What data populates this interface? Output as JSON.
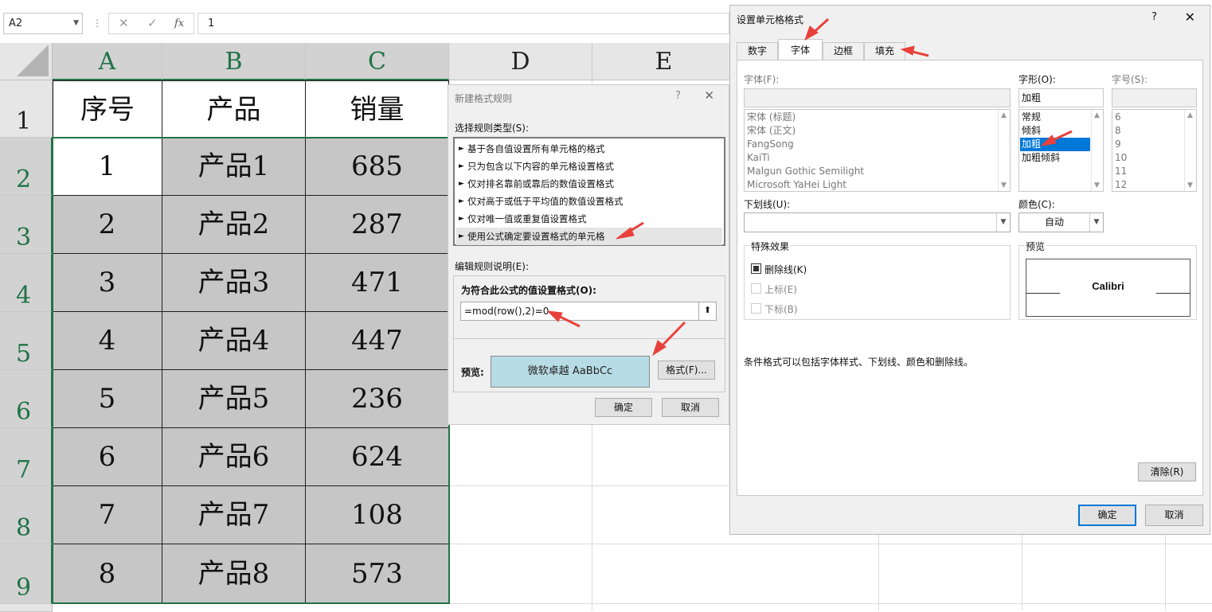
{
  "formula_bar": {
    "name_box": "A2",
    "cancel_icon": "✕",
    "enter_icon": "✓",
    "fx_icon": "fx",
    "value": "1"
  },
  "columns": [
    "A",
    "B",
    "C",
    "D",
    "E"
  ],
  "rows": [
    "1",
    "2",
    "3",
    "4",
    "5",
    "6",
    "7",
    "8",
    "9"
  ],
  "table": {
    "headers": [
      "序号",
      "产品",
      "销量"
    ],
    "data": [
      [
        "1",
        "产品1",
        "685"
      ],
      [
        "2",
        "产品2",
        "287"
      ],
      [
        "3",
        "产品3",
        "471"
      ],
      [
        "4",
        "产品4",
        "447"
      ],
      [
        "5",
        "产品5",
        "236"
      ],
      [
        "6",
        "产品6",
        "624"
      ],
      [
        "7",
        "产品7",
        "108"
      ],
      [
        "8",
        "产品8",
        "573"
      ]
    ]
  },
  "new_rule_dialog": {
    "title": "新建格式规则",
    "help": "?",
    "close": "✕",
    "select_type_label": "选择规则类型(S):",
    "rule_types": [
      "基于各自值设置所有单元格的格式",
      "只为包含以下内容的单元格设置格式",
      "仅对排名靠前或靠后的数值设置格式",
      "仅对高于或低于平均值的数值设置格式",
      "仅对唯一值或重复值设置格式",
      "使用公式确定要设置格式的单元格"
    ],
    "edit_desc_label": "编辑规则说明(E):",
    "formula_label": "为符合此公式的值设置格式(O):",
    "formula_value": "=mod(row(),2)=0",
    "collapse_icon": "⬆",
    "preview_label": "预览:",
    "preview_text": "微软卓越  AaBbCc",
    "format_button": "格式(F)...",
    "ok_button": "确定",
    "cancel_button": "取消"
  },
  "format_cells_dialog": {
    "title": "设置单元格格式",
    "help": "?",
    "close": "✕",
    "tabs": [
      "数字",
      "字体",
      "边框",
      "填充"
    ],
    "font_label": "字体(F):",
    "font_value": "",
    "font_list": [
      "宋体 (标题)",
      "宋体 (正文)",
      "FangSong",
      "KaiTi",
      "Malgun Gothic Semilight",
      "Microsoft YaHei Light"
    ],
    "style_label": "字形(O):",
    "style_value": "加粗",
    "style_list": [
      "常规",
      "倾斜",
      "加粗",
      "加粗倾斜"
    ],
    "size_label": "字号(S):",
    "size_value": "",
    "size_list": [
      "6",
      "8",
      "9",
      "10",
      "11",
      "12"
    ],
    "underline_label": "下划线(U):",
    "underline_value": "",
    "color_label": "颜色(C):",
    "color_value": "自动",
    "effects_label": "特殊效果",
    "strikethrough": "删除线(K)",
    "superscript": "上标(E)",
    "subscript": "下标(B)",
    "preview_label": "预览",
    "preview_text": "Calibri",
    "note": "条件格式可以包括字体样式、下划线、颜色和删除线。",
    "clear_button": "清除(R)",
    "ok_button": "确定",
    "cancel_button": "取消"
  },
  "colors": {
    "excel_green": "#217346",
    "cell_gray": "#c6c6c6",
    "preview_blue": "#b8dce6",
    "selection_blue": "#0078d7",
    "arrow_red": "#e8413c"
  }
}
